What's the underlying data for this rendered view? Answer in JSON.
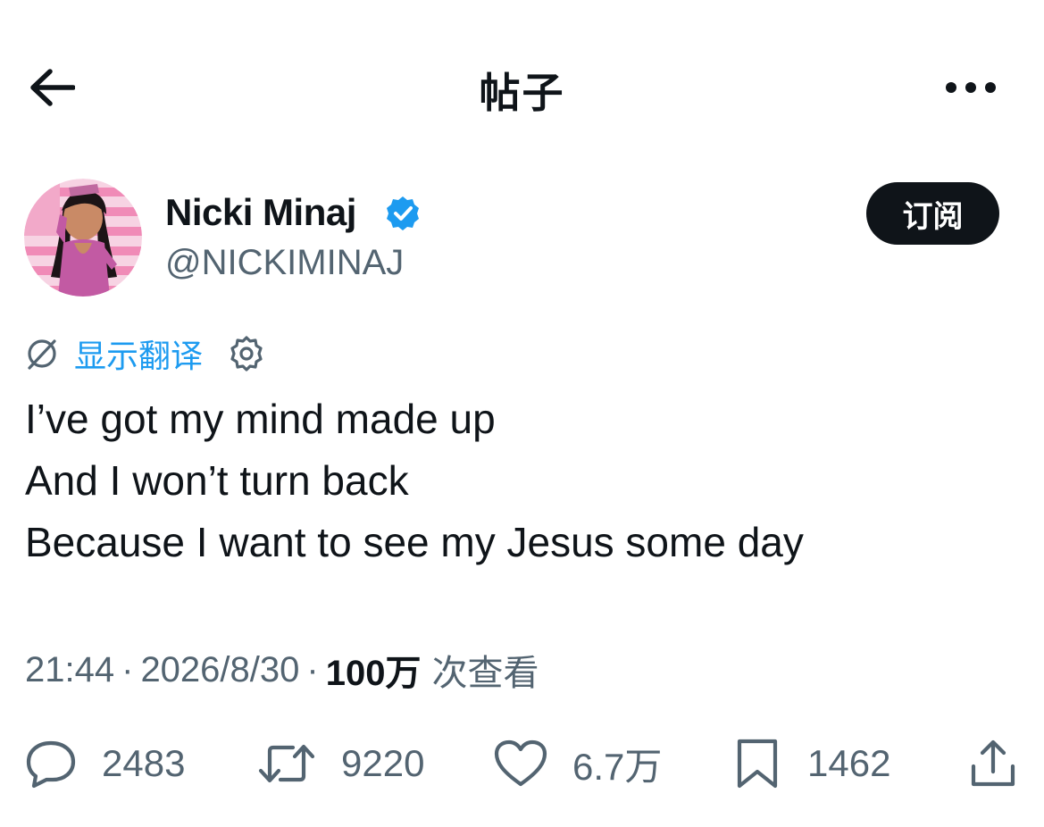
{
  "header": {
    "title": "帖子"
  },
  "author": {
    "name": "Nicki Minaj",
    "handle": "@NICKIMINAJ",
    "verified": true,
    "subscribe_label": "订阅"
  },
  "translate": {
    "label": "显示翻译"
  },
  "post": {
    "lines": [
      "I’ve got my mind made up",
      "And I won’t turn back",
      "Because I want to see my Jesus some day"
    ]
  },
  "meta": {
    "time": "21:44",
    "separator": "·",
    "date": "2026/8/30",
    "views_count": "100万",
    "views_label": "次查看"
  },
  "actions": {
    "replies": "2483",
    "reposts": "9220",
    "likes": "6.7万",
    "bookmarks": "1462"
  },
  "colors": {
    "accent": "#1d9bf0",
    "text": "#0f1419",
    "muted": "#536471"
  },
  "icons": {
    "back": "arrow-left-icon",
    "more": "more-horizontal-icon",
    "verified": "verified-badge-icon",
    "translate": "translate-icon",
    "settings": "gear-icon",
    "reply": "reply-icon",
    "repost": "repost-icon",
    "like": "heart-icon",
    "bookmark": "bookmark-icon",
    "share": "share-icon"
  }
}
